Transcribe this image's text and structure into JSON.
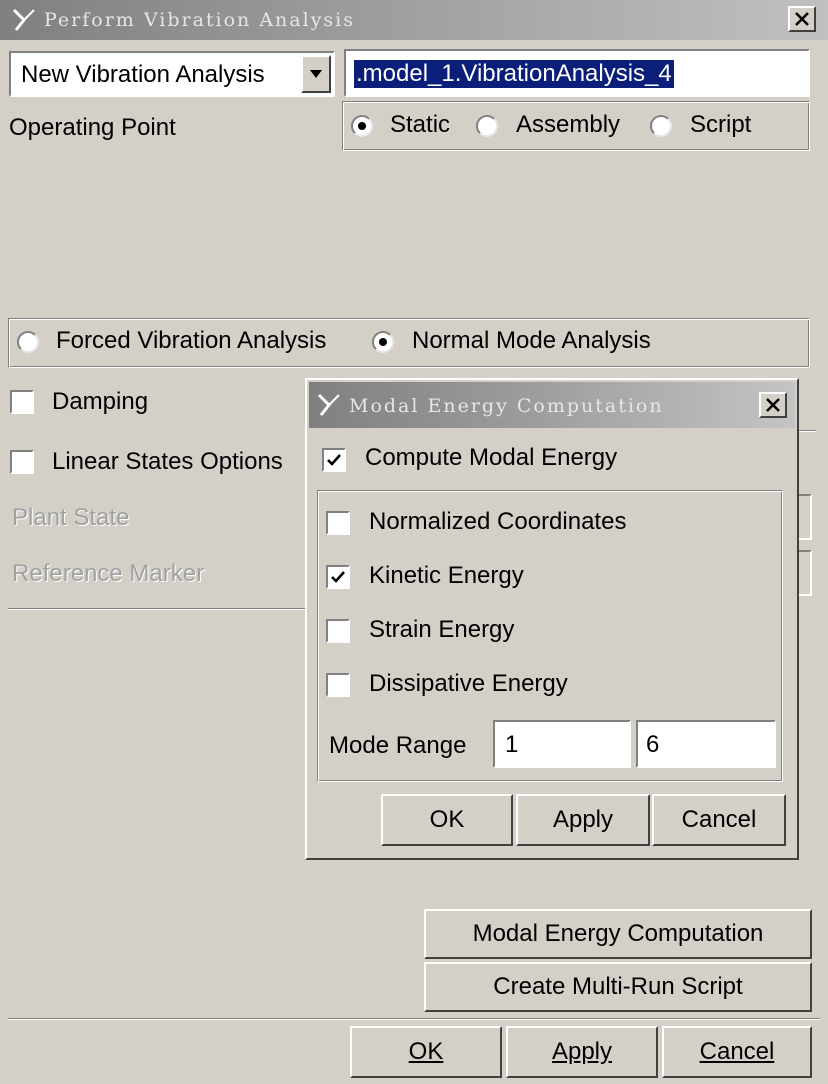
{
  "window": {
    "title": "Perform Vibration Analysis"
  },
  "analysis_select": {
    "value": "New Vibration Analysis"
  },
  "analysis_name": {
    "value": ".model_1.VibrationAnalysis_4"
  },
  "operating_point": {
    "label": "Operating Point",
    "options": [
      {
        "label": "Static",
        "selected": true
      },
      {
        "label": "Assembly",
        "selected": false
      },
      {
        "label": "Script",
        "selected": false
      }
    ]
  },
  "analysis_type": {
    "options": [
      {
        "label": "Forced Vibration Analysis",
        "selected": false
      },
      {
        "label": "Normal Mode Analysis",
        "selected": true
      }
    ]
  },
  "damping": {
    "label": "Damping",
    "checked": false
  },
  "linear_states": {
    "label": "Linear States Options",
    "checked": false
  },
  "plant_state": {
    "label": "Plant State"
  },
  "reference_marker": {
    "label": "Reference Marker"
  },
  "buttons": {
    "modal_energy": "Modal Energy Computation",
    "multi_run": "Create Multi-Run Script",
    "ok": "OK",
    "apply": "Apply",
    "cancel": "Cancel"
  },
  "dialog": {
    "title": "Modal Energy Computation",
    "compute": {
      "label": "Compute Modal Energy",
      "checked": true
    },
    "options": [
      {
        "label": "Normalized Coordinates",
        "checked": false
      },
      {
        "label": "Kinetic Energy",
        "checked": true
      },
      {
        "label": "Strain Energy",
        "checked": false
      },
      {
        "label": "Dissipative Energy",
        "checked": false
      }
    ],
    "mode_range": {
      "label": "Mode Range",
      "from": "1",
      "to": "6"
    },
    "buttons": {
      "ok": "OK",
      "apply": "Apply",
      "cancel": "Cancel"
    }
  }
}
